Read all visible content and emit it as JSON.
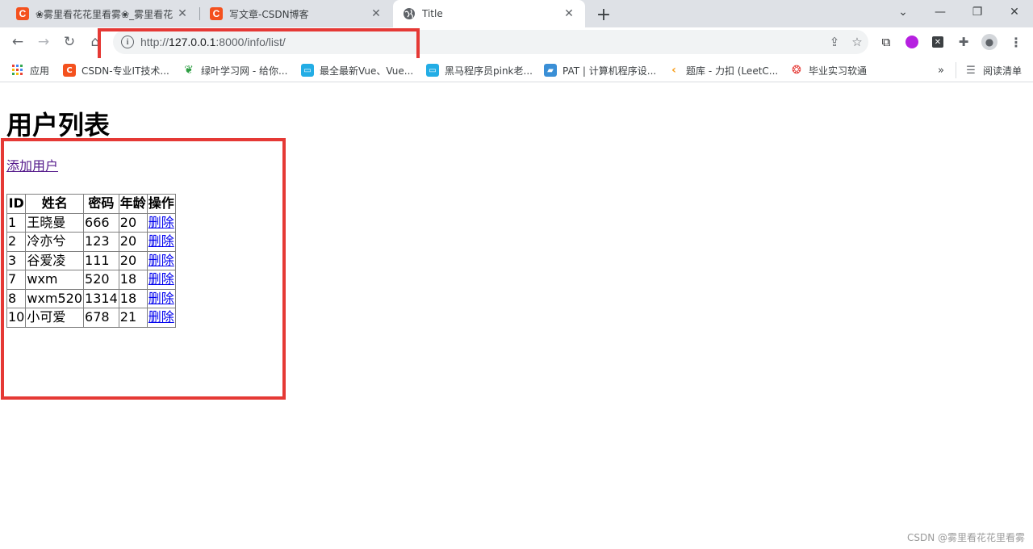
{
  "browser": {
    "tabs": [
      {
        "title": "❀雾里看花花里看雾❀_雾里看花",
        "icon": "csdn-icon"
      },
      {
        "title": "写文章-CSDN博客",
        "icon": "csdn-icon"
      },
      {
        "title": "Title",
        "icon": "globe-icon",
        "active": true
      }
    ],
    "address": {
      "scheme": "http://",
      "host": "127.0.0.1",
      "rest": ":8000/info/list/"
    },
    "bookmarks": [
      {
        "label": "应用",
        "icon": "apps-grid-icon"
      },
      {
        "label": "CSDN-专业IT技术...",
        "icon": "csdn-icon",
        "color": "#f4511e"
      },
      {
        "label": "绿叶学习网 - 给你...",
        "icon": "leaf-icon",
        "color": "#2e9e43"
      },
      {
        "label": "最全最新Vue、Vue...",
        "icon": "bilibili-icon",
        "color": "#23ade5"
      },
      {
        "label": "黑马程序员pink老...",
        "icon": "bilibili-icon",
        "color": "#23ade5"
      },
      {
        "label": "PAT | 计算机程序设...",
        "icon": "pat-icon",
        "color": "#3a8fd6"
      },
      {
        "label": "题库 - 力扣 (LeetC...",
        "icon": "leetcode-icon",
        "color": "#f89f1b"
      },
      {
        "label": "毕业实习软通",
        "icon": "softstone-icon",
        "color": "#e53935"
      }
    ],
    "bookmarks_overflow": "»",
    "reading_list": "阅读清单"
  },
  "page": {
    "title": "用户列表",
    "add_link": "添加用户",
    "table": {
      "headers": [
        "ID",
        "姓名",
        "密码",
        "年龄",
        "操作"
      ],
      "rows": [
        {
          "id": "1",
          "name": "王晓曼",
          "password": "666",
          "age": "20",
          "action": "删除"
        },
        {
          "id": "2",
          "name": "冷亦兮",
          "password": "123",
          "age": "20",
          "action": "删除"
        },
        {
          "id": "3",
          "name": "谷爱凌",
          "password": "111",
          "age": "20",
          "action": "删除"
        },
        {
          "id": "7",
          "name": "wxm",
          "password": "520",
          "age": "18",
          "action": "删除"
        },
        {
          "id": "8",
          "name": "wxm520",
          "password": "1314",
          "age": "18",
          "action": "删除"
        },
        {
          "id": "10",
          "name": "小可爱",
          "password": "678",
          "age": "21",
          "action": "删除"
        }
      ]
    }
  },
  "watermark": "CSDN @雾里看花花里看雾",
  "colors": {
    "annotation": "#e53935",
    "link": "#0000ee",
    "visited_link": "#551a8b"
  }
}
